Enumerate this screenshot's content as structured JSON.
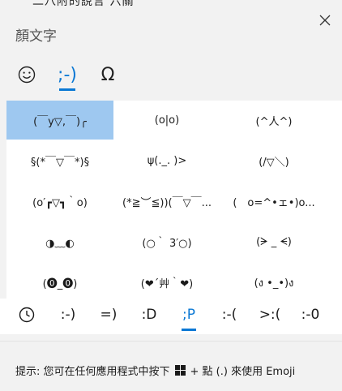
{
  "peek_text": "二八附的說言 六關",
  "panel": {
    "title": "顏文字",
    "close_label": "✕"
  },
  "category_tabs": [
    {
      "name": "emoji",
      "glyph": "☺",
      "active": false
    },
    {
      "name": "kaomoji",
      "glyph": ";-)",
      "active": true
    },
    {
      "name": "symbols",
      "glyph": "Ω",
      "active": false
    }
  ],
  "kaomoji": [
    [
      "(￣y▽,￣)╭",
      "(o|o)",
      "(^人^)"
    ],
    [
      "§(*￣▽￣*)§",
      "ψ(._. )>",
      "(/▽＼)"
    ],
    [
      "(o′┏▽┓｀o)",
      "(*≧︶≦))(￣▽￣...",
      "(　o=^•ェ•)o..."
    ],
    [
      "◑﹏◐",
      "(○｀ 3′○)",
      "(ᗒ _ ᗕ)"
    ],
    [
      "(⓿_⓿)",
      "(❤´艸｀❤)",
      "(ง •_•)ง"
    ]
  ],
  "selected_cell": [
    0,
    0
  ],
  "bottom_tabs": [
    {
      "name": "recent",
      "label": "",
      "active": false
    },
    {
      "name": "smile",
      "label": ":-)",
      "active": false
    },
    {
      "name": "happy",
      "label": "=)",
      "active": false
    },
    {
      "name": "laugh",
      "label": ":D",
      "active": false
    },
    {
      "name": "tongue",
      "label": ";P",
      "active": true
    },
    {
      "name": "sad",
      "label": ":-(",
      "active": false
    },
    {
      "name": "angry",
      "label": ">:(",
      "active": false
    },
    {
      "name": "neutral",
      "label": ":-0",
      "active": false
    }
  ],
  "footer": {
    "hint_prefix": "提示: 您可在任何應用程式中按下",
    "hint_suffix": "+ 點 (.) 來使用 Emoji"
  },
  "colors": {
    "accent": "#0a78d4",
    "selected_bg": "#9ec8f0"
  }
}
